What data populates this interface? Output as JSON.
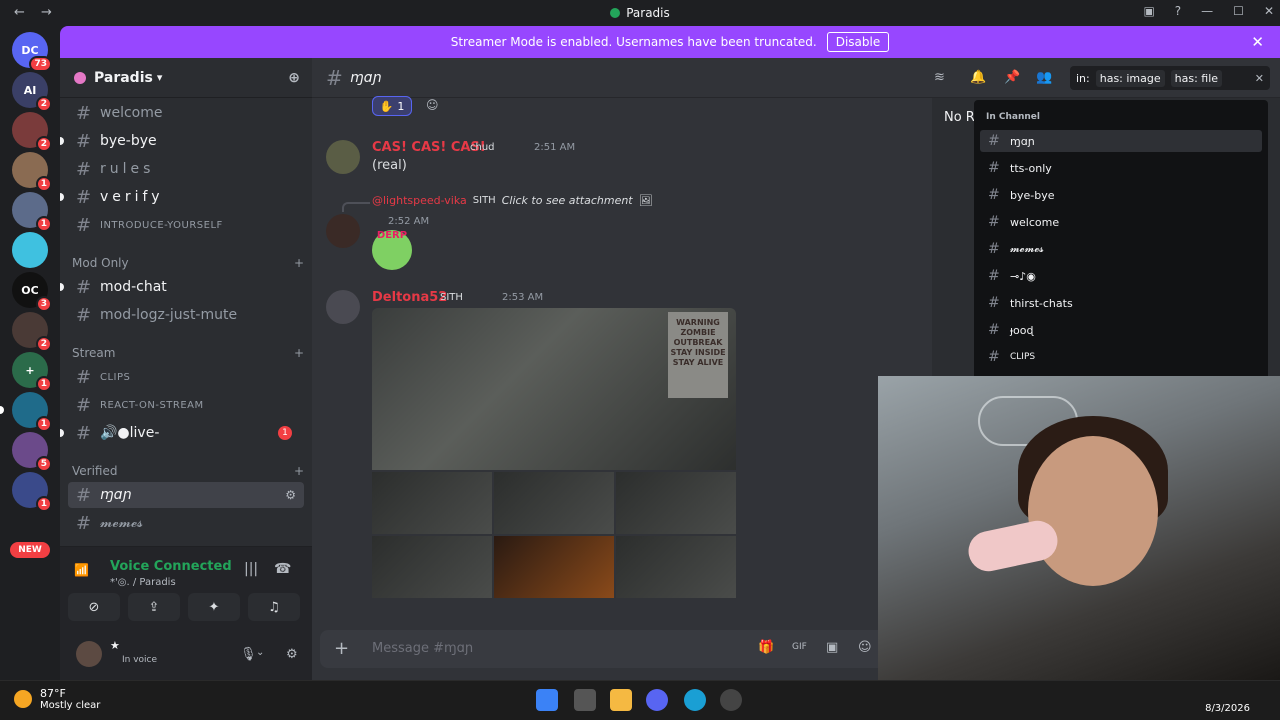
{
  "titlebar": {
    "back": "←",
    "forward": "→",
    "title": "Paradis",
    "min": "—",
    "max": "☐",
    "close": "✕",
    "inbox": "▣",
    "help": "?"
  },
  "banner": {
    "text": "Streamer Mode is enabled. Usernames have been truncated.",
    "disable_label": "Disable",
    "close": "✕"
  },
  "servers": [
    {
      "label": "DC",
      "badge": "73"
    },
    {
      "label": "AI",
      "badge": "2"
    },
    {
      "label": "",
      "badge": "2"
    },
    {
      "label": "",
      "badge": "1"
    },
    {
      "label": "",
      "badge": "1"
    },
    {
      "label": "",
      "badge": ""
    },
    {
      "label": "OC",
      "badge": "3"
    },
    {
      "label": "",
      "badge": "2"
    },
    {
      "label": "+",
      "badge": "1"
    },
    {
      "label": "",
      "badge": "1"
    },
    {
      "label": "",
      "badge": "5"
    },
    {
      "label": "",
      "badge": "1"
    }
  ],
  "new_badge": "NEW",
  "guild": {
    "name": "Paradis",
    "chevron": "▾"
  },
  "channels": {
    "welcome": "welcome",
    "bye_bye": "bye-bye",
    "rules": "rules",
    "verify": "verify",
    "introduce": "INTRODUCE-YOURSELF",
    "cat_mod": "Mod Only",
    "mod_chat": "mod-chat",
    "mod_logz": "mod-logz-just-mute",
    "cat_stream": "Stream",
    "clips": "CLIPS",
    "react": "REACT-ON-STREAM",
    "live": "live-",
    "live_badge": "1",
    "cat_verified": "Verified",
    "mqn": "ɱɑɲ",
    "memes": "𝓶𝓮𝓶𝓮𝓼"
  },
  "voice": {
    "status": "Voice Connected",
    "location": "*'◎. / Paradis"
  },
  "user": {
    "name": "★",
    "status": "In voice"
  },
  "header": {
    "channel": "ɱɑɲ"
  },
  "search": {
    "prefix": "in:",
    "tag1": "has: image",
    "tag2": "has: file",
    "clear": "✕"
  },
  "messages": {
    "reaction_count": "1",
    "m1_user": "CAS! CAS! CAS!",
    "m1_role": "chud",
    "m1_time": "2:51 AM",
    "m1_text": "(real)",
    "m2_reply_user": "@lightspeed-vika",
    "m2_reply_role": "SITH",
    "m2_reply_text": "Click to see attachment",
    "m2_time": "2:52 AM",
    "sticker": "DERP",
    "m3_user": "Deltona52",
    "m3_role": "SITH",
    "m3_time": "2:53 AM",
    "warning": "WARNING ZOMBIE OUTBREAK STAY INSIDE STAY ALIVE"
  },
  "composer": {
    "placeholder": "Message #ɱɑɲ",
    "plus": "+"
  },
  "results": {
    "no_results": "No R"
  },
  "popout": {
    "heading": "In Channel",
    "items": [
      "ɱɑɲ",
      "tts-only",
      "bye-bye",
      "welcome",
      "𝓶𝓮𝓶𝓮𝓼",
      "⊸♪◉",
      "thirst-chats",
      "ɟooɖ",
      "CLIPS"
    ]
  },
  "taskbar": {
    "temp": "87°F",
    "condition": "Mostly clear",
    "date": "8/3/2026"
  },
  "colors": {
    "accent": "#9747ff",
    "online": "#23a55a",
    "mention": "#f23f43"
  }
}
